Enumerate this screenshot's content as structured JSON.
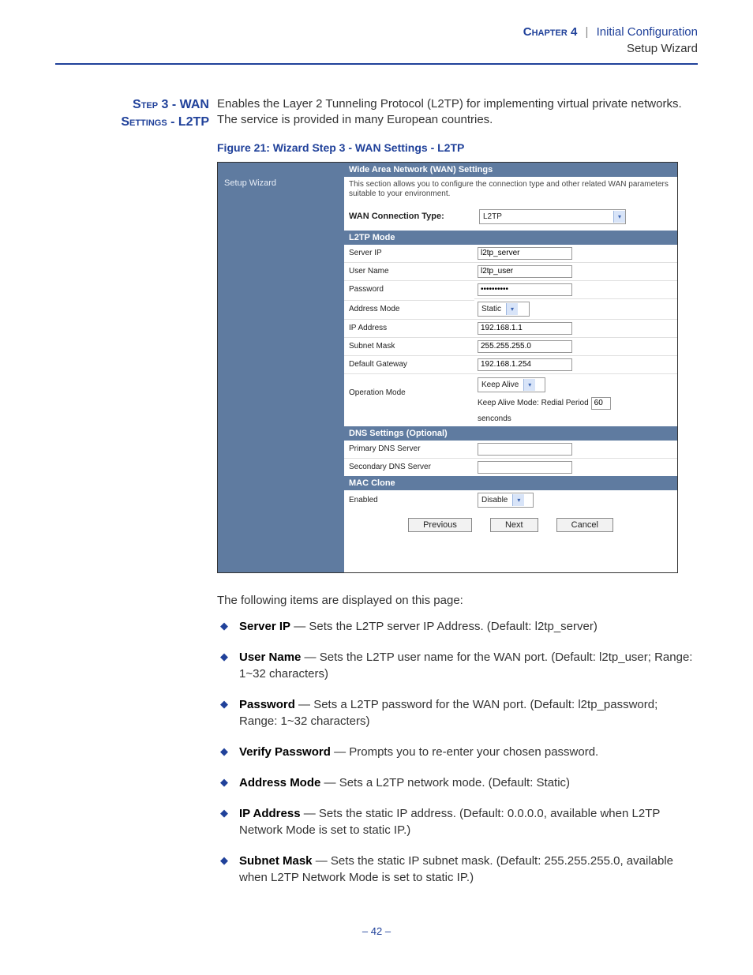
{
  "header": {
    "chapter": "Chapter 4",
    "sep": "|",
    "crumb": "Initial Configuration",
    "sub": "Setup Wizard"
  },
  "side_heading": {
    "line1": "Step 3 - WAN",
    "line2": "Settings - L2TP"
  },
  "intro_para": "Enables the Layer 2 Tunneling Protocol (L2TP) for implementing virtual private networks. The service is provided in many European countries.",
  "figure_caption": "Figure 21:  Wizard Step 3 - WAN Settings - L2TP",
  "shot": {
    "sidebar_item": "Setup Wizard",
    "title_bar": "Wide Area Network (WAN) Settings",
    "desc": "This section allows you to configure the connection type and other related WAN parameters suitable to your environment.",
    "wan_label": "WAN Connection Type:",
    "wan_value": "L2TP",
    "section_l2tp": "L2TP Mode",
    "rows": [
      {
        "label": "Server IP",
        "value": "l2tp_server",
        "type": "text"
      },
      {
        "label": "User Name",
        "value": "l2tp_user",
        "type": "text"
      },
      {
        "label": "Password",
        "value": "••••••••••",
        "type": "text"
      },
      {
        "label": "Address Mode",
        "value": "Static",
        "type": "select"
      },
      {
        "label": "IP Address",
        "value": "192.168.1.1",
        "type": "text"
      },
      {
        "label": "Subnet Mask",
        "value": "255.255.255.0",
        "type": "text"
      },
      {
        "label": "Default Gateway",
        "value": "192.168.1.254",
        "type": "text"
      }
    ],
    "op_mode": {
      "label": "Operation Mode",
      "select": "Keep Alive",
      "text_prefix": "Keep Alive Mode: Redial Period",
      "text_value": "60",
      "text_suffix": "senconds"
    },
    "section_dns": "DNS Settings (Optional)",
    "dns_rows": [
      {
        "label": "Primary DNS Server",
        "value": ""
      },
      {
        "label": "Secondary DNS Server",
        "value": ""
      }
    ],
    "section_mac": "MAC Clone",
    "mac_row": {
      "label": "Enabled",
      "value": "Disable"
    },
    "buttons": {
      "prev": "Previous",
      "next": "Next",
      "cancel": "Cancel"
    }
  },
  "items_intro": "The following items are displayed on this page:",
  "bullets": [
    {
      "b": "Server IP",
      "t": " — Sets the L2TP server IP Address. (Default: l2tp_server)"
    },
    {
      "b": "User Name",
      "t": " — Sets the L2TP user name for the WAN port. (Default: l2tp_user; Range: 1~32 characters)"
    },
    {
      "b": "Password",
      "t": " — Sets a L2TP password for the WAN port. (Default: l2tp_password; Range: 1~32 characters)"
    },
    {
      "b": "Verify Password",
      "t": " — Prompts you to re-enter your chosen password."
    },
    {
      "b": "Address Mode",
      "t": " — Sets a L2TP network mode. (Default: Static)"
    },
    {
      "b": "IP Address",
      "t": " — Sets the static IP address. (Default: 0.0.0.0, available when L2TP Network Mode is set to static IP.)"
    },
    {
      "b": "Subnet Mask",
      "t": " — Sets the static IP subnet mask. (Default: 255.255.255.0, available when L2TP Network Mode is set to static IP.)"
    }
  ],
  "page_number": "–  42  –"
}
